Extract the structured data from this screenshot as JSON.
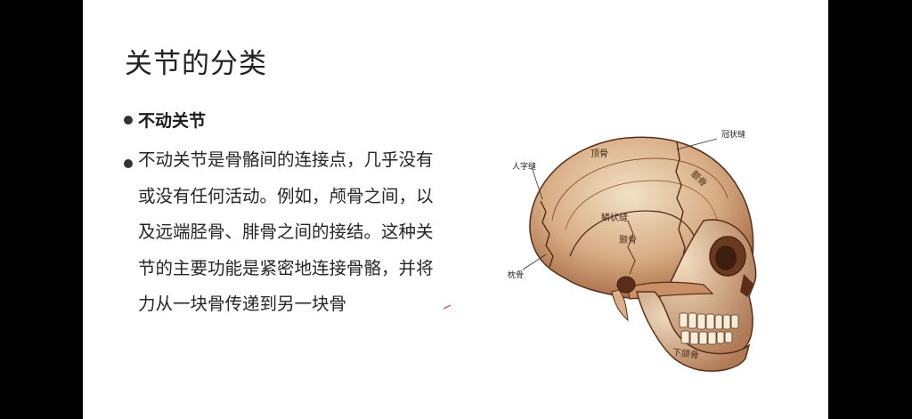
{
  "slide": {
    "title": "关节的分类",
    "bullets": [
      {
        "text": "不动关节"
      },
      {
        "text": "不动关节是骨骼间的连接点，几乎没有或没有任何活动。例如，颅骨之间，以及远端胫骨、腓骨之间的接结。这种关节的主要功能是紧密地连接骨骼，并将力从一块骨传递到另一块骨"
      }
    ]
  },
  "figure": {
    "labels": {
      "coronal_suture": "冠状缝",
      "lambdoid_suture": "人字缝",
      "parietal": "顶骨",
      "frontal": "额骨",
      "squamous_suture": "鳞状缝",
      "temporal": "颞骨",
      "occipital": "枕骨",
      "mandible": "下颌骨"
    }
  },
  "colors": {
    "bone_light": "#f1e1c6",
    "bone_mid": "#c9926a",
    "bone_dark": "#7a4628",
    "outline": "#5a2e18"
  }
}
